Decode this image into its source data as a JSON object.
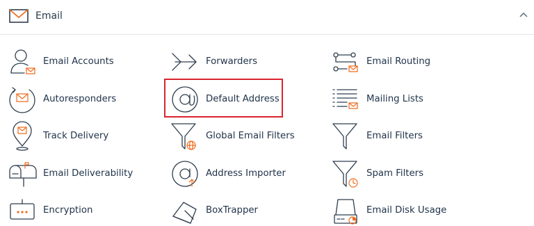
{
  "header": {
    "title": "Email"
  },
  "colors": {
    "accent": "#ef6c1d",
    "highlight": "#d9232d",
    "text": "#22344a"
  },
  "items": [
    {
      "label": "Email Accounts",
      "icon": "user-mail-icon"
    },
    {
      "label": "Forwarders",
      "icon": "forward-arrow-icon"
    },
    {
      "label": "Email Routing",
      "icon": "routing-icon"
    },
    {
      "label": "Autoresponders",
      "icon": "autoresponder-icon"
    },
    {
      "label": "Default Address",
      "icon": "at-sign-icon"
    },
    {
      "label": "Mailing Lists",
      "icon": "mailing-list-icon"
    },
    {
      "label": "Track Delivery",
      "icon": "location-pin-mail-icon"
    },
    {
      "label": "Global Email Filters",
      "icon": "funnel-globe-icon"
    },
    {
      "label": "Email Filters",
      "icon": "funnel-icon"
    },
    {
      "label": "Email Deliverability",
      "icon": "mailbox-icon"
    },
    {
      "label": "Address Importer",
      "icon": "at-import-icon"
    },
    {
      "label": "Spam Filters",
      "icon": "funnel-clock-icon"
    },
    {
      "label": "Encryption",
      "icon": "key-card-icon"
    },
    {
      "label": "BoxTrapper",
      "icon": "trap-icon"
    },
    {
      "label": "Email Disk Usage",
      "icon": "disk-usage-icon"
    }
  ]
}
